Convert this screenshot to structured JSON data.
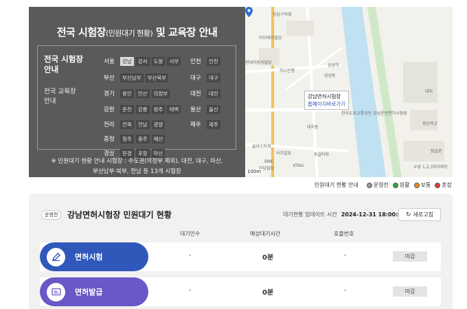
{
  "panel": {
    "title_main": "전국 시험장",
    "title_sub": "(민원대기 현황)",
    "title_end": "및 교육장 안내",
    "label_test_line1": "전국 시험장",
    "label_test_line2": "안내",
    "label_edu_line1": "전국 교육장",
    "label_edu_line2": "안내",
    "regions": [
      {
        "name": "서울",
        "tags": [
          "강남",
          "강서",
          "도봉",
          "서부"
        ]
      },
      {
        "name": "인천",
        "tags": [
          "인천"
        ]
      },
      {
        "name": "부산",
        "tags": [
          "부산남부",
          "부산북부"
        ]
      },
      {
        "name": "대구",
        "tags": [
          "대구"
        ]
      },
      {
        "name": "경기",
        "tags": [
          "용인",
          "안산",
          "의정부"
        ]
      },
      {
        "name": "대전",
        "tags": [
          "대전"
        ]
      },
      {
        "name": "강원",
        "tags": [
          "춘천",
          "강릉",
          "원주",
          "태백"
        ]
      },
      {
        "name": "울산",
        "tags": [
          "울산"
        ]
      },
      {
        "name": "전라",
        "tags": [
          "전북",
          "전남",
          "광양"
        ]
      },
      {
        "name": "제주",
        "tags": [
          "제주"
        ]
      },
      {
        "name": "충청",
        "tags": [
          "청주",
          "충주",
          "예산"
        ]
      },
      {
        "name": "경상",
        "tags": [
          "문경",
          "포항",
          "마산"
        ]
      }
    ],
    "note_line1": "※ 민원대기 현황 안내 시험장 : 수도권(의정부 제외), 대전, 대구, 마산,",
    "note_line2": "부산남부·북부, 전남 등 13개 시험장"
  },
  "map": {
    "popup_title": "강남면허시험장",
    "popup_link": "홈페이지바로가기",
    "labels": [
      "강남구의회",
      "삼성동",
      "대치",
      "한국도로교통공단 강남운전면허시험장",
      "하니은행",
      "삼성역",
      "서울",
      "대치동",
      "동일타워",
      "사조빌딩",
      "BNK",
      "강남빌딩",
      "골라스타워",
      "아이케이빌딩",
      "정신여고",
      "잠실로",
      "우성 1,2,3차아파트",
      "현대자동차빌딩",
      "KTAG"
    ],
    "scale_label": "100m"
  },
  "legend": {
    "title": "민원대기 현황 안내",
    "items": [
      {
        "label": "운영전",
        "color": "#9a9a9a"
      },
      {
        "label": "원활",
        "color": "#2fa83a"
      },
      {
        "label": "보통",
        "color": "#f08b1a"
      },
      {
        "label": "혼잡",
        "color": "#e23a3a"
      }
    ]
  },
  "status": {
    "badge": "운영전",
    "title": "강남면허시험장 민원대기 현황",
    "updated_label": "대기현황 업데이트 시간",
    "updated_value": "2024-12-31 18:00:00",
    "refresh_label": "새로고침",
    "columns": [
      "대기인수",
      "예상대기시간",
      "호출번호"
    ],
    "rows": [
      {
        "name": "면허시험",
        "waiting": "-",
        "expected": "0분",
        "call": "-",
        "state": "마감"
      },
      {
        "name": "면허발급",
        "waiting": "-",
        "expected": "0분",
        "call": "-",
        "state": "마감"
      }
    ]
  }
}
